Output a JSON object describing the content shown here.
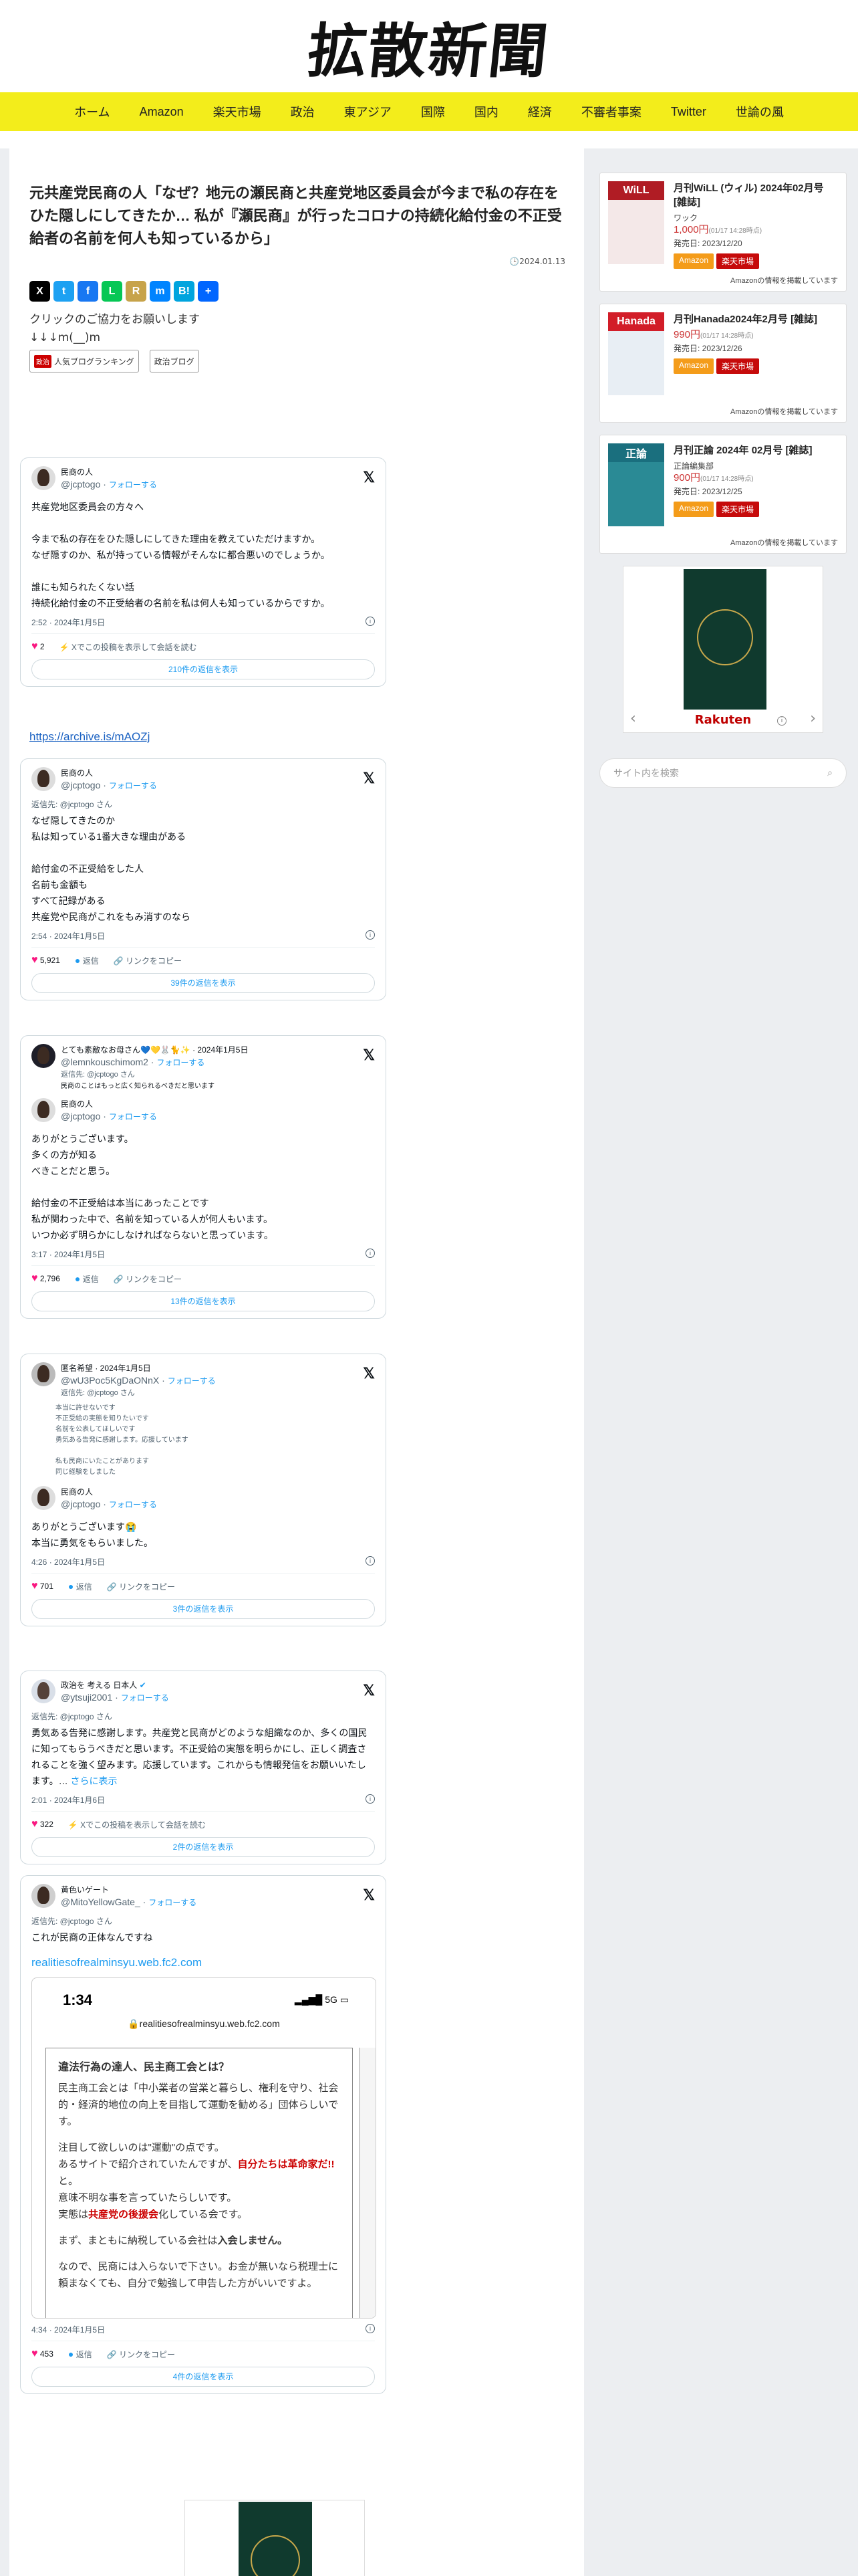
{
  "site": {
    "logo": "拡散新聞"
  },
  "nav": [
    "ホーム",
    "Amazon",
    "楽天市場",
    "政治",
    "東アジア",
    "国際",
    "国内",
    "経済",
    "不審者事案",
    "Twitter",
    "世論の風"
  ],
  "article": {
    "title": "元共産党民商の人「なぜ？地元の瀬民商と共産党地区委員会が今まで私の存在をひた隠しにしてきたか… 私が『瀬民商』が行ったコロナの持続化給付金の不正受給者の名前を何人も知っているから」",
    "date": "2024.01.13",
    "share_icons": [
      {
        "label": "X",
        "color": "#000000"
      },
      {
        "label": "t",
        "color": "#1da1f2"
      },
      {
        "label": "f",
        "color": "#1877f2"
      },
      {
        "label": "L",
        "color": "#06c755"
      },
      {
        "label": "R",
        "color": "#c7a34a"
      },
      {
        "label": "m",
        "color": "#0084ff"
      },
      {
        "label": "B!",
        "color": "#00a4de"
      },
      {
        "label": "+",
        "color": "#0166ff"
      }
    ],
    "click_text": "クリックのご協力をお願いします",
    "arrow_text": "↓↓↓m(__)m",
    "banner1": {
      "mark": "政治",
      "label": "人気ブログランキング"
    },
    "banner2": {
      "label": "政治ブログ"
    },
    "archive_link": "https://archive.is/mAOZj"
  },
  "tweets": [
    {
      "name": "民商の人",
      "handle": "@jcptogo",
      "follow": "フォローする",
      "body": "共産党地区委員会の方々へ\n\n今まで私の存在をひた隠しにしてきた理由を教えていただけますか。\nなぜ隠すのか、私が持っている情報がそんなに都合悪いのでしょうか。\n\n誰にも知られたくない話\n持続化給付金の不正受給者の名前を私は何人も知っているからですか。",
      "time": "2:52 · 2024年1月5日",
      "likes": "2",
      "reply_label": "Xでこの投稿を表示して会話を読む",
      "more": "210件の返信を表示"
    },
    {
      "name": "民商の人",
      "handle": "@jcptogo",
      "follow": "フォローする",
      "reply_to": "返信先: @jcptogo さん",
      "body": "なぜ隠してきたのか\n私は知っている1番大きな理由がある\n\n給付金の不正受給をした人\n名前も金額も\nすべて記録がある\n共産党や民商がこれをもみ消すのなら",
      "time": "2:54 · 2024年1月5日",
      "likes": "5,921",
      "reply_label": "返信",
      "copy_label": "リンクをコピー",
      "more": "39件の返信を表示"
    },
    {
      "name": "とても素敵なお母さん💙💛🐰🐈✨",
      "date": "· 2024年1月5日",
      "handle": "@lemnkouschimom2",
      "follow": "フォローする",
      "reply_to": "返信先: @jcptogo さん",
      "quote_text": "民商のことはもっと広く知られるべきだと思います",
      "name2": "民商の人",
      "handle2": "@jcptogo",
      "follow2": "フォローする",
      "body": "ありがとうございます。\n多くの方が知る\nべきことだと思う。\n\n給付金の不正受給は本当にあったことです\n私が関わった中で、名前を知っている人が何人もいます。\nいつか必ず明らかにしなければならないと思っています。",
      "time": "3:17 · 2024年1月5日",
      "likes": "2,796",
      "reply_label": "返信",
      "copy_label": "リンクをコピー",
      "more": "13件の返信を表示"
    },
    {
      "name": "匿名希望 · 2024年1月5日",
      "handle": "@wU3Poc5KgDaONnX",
      "follow": "フォローする",
      "reply_to": "返信先: @jcptogo さん",
      "quote_lines": [
        "本当に許せないです",
        "不正受給の実態を知りたいです",
        "名前を公表してほしいです",
        "勇気ある告発に感謝します。応援しています",
        "",
        "私も民商にいたことがあります",
        "同じ経験をしました"
      ],
      "name2": "民商の人",
      "handle2": "@jcptogo",
      "follow2": "フォローする",
      "body": "ありがとうございます😭\n本当に勇気をもらいました。",
      "time": "4:26 · 2024年1月5日",
      "likes": "701",
      "reply_label": "返信",
      "copy_label": "リンクをコピー",
      "more": "3件の返信を表示"
    },
    {
      "name": "政治を 考える 日本人",
      "handle": "@ytsuji2001",
      "follow": "フォローする",
      "reply_to": "返信先: @jcptogo さん",
      "body": "勇気ある告発に感謝します。共産党と民商がどのような組織なのか、多くの国民に知ってもらうべきだと思います。不正受給の実態を明らかにし、正しく調査されることを強く望みます。応援しています。これからも情報発信をお願いいたします。…",
      "more_inline": "さらに表示",
      "time": "2:01 · 2024年1月6日",
      "likes": "322",
      "reply_label": "Xでこの投稿を表示して会話を読む",
      "more": "2件の返信を表示"
    },
    {
      "name": "黄色いゲート",
      "handle": "@MitoYellowGate_",
      "follow": "フォローする",
      "reply_to": "返信先: @jcptogo さん",
      "body": "これが民商の正体なんですね",
      "link": "realitiesofrealminsyu.web.fc2.com",
      "phone": {
        "time": "1:34",
        "signal": "5G",
        "url": "realitiesofrealminsyu.web.fc2.com",
        "heading": "違法行為の達人、民主商工会とは？",
        "p1": "民主商工会とは「中小業者の営業と暮らし、権利を守り、社会的・経済的地位の向上を目指して運動を勧める」団体らしいです。",
        "p2a": "注目して欲しいのは\"運動\"の点です。",
        "p2b": "あるサイトで紹介されていたんですが、",
        "p2red": "自分たちは革命家だ!!",
        "p2c": "と。",
        "p2d": "意味不明な事を言っていたらしいです。",
        "p2e": "実態は",
        "p2red2": "共産党の後援会",
        "p2f": "化している会です。",
        "p3a": "まず、まともに納税している会社は",
        "p3b": "入会しません。",
        "p4": "なので、民商には入らないで下さい。お金が無いなら税理士に頼まなくても、自分で勉強して申告した方がいいですよ。"
      },
      "time": "4:34 · 2024年1月5日",
      "likes": "453",
      "reply_label": "返信",
      "copy_label": "リンクをコピー",
      "more": "4件の返信を表示"
    }
  ],
  "sidebar": {
    "books": [
      {
        "title": "月刊WiLL (ウィル) 2024年02月号 [雑誌]",
        "publisher": "ワック",
        "price": "1,000円",
        "price_note": "(01/17 14:28時点)",
        "release": "発売日: 2023/12/20",
        "cover_label": "WiLL",
        "cover_color": "#b01c24",
        "amazon": "Amazon",
        "rakuten": "楽天市場",
        "note": "Amazonの情報を掲載しています"
      },
      {
        "title": "月刊Hanada2024年2月号 [雑誌]",
        "publisher": "",
        "price": "990円",
        "price_note": "(01/17 14:28時点)",
        "release": "発売日: 2023/12/26",
        "cover_label": "Hanada",
        "cover_color": "#d21d28",
        "amazon": "Amazon",
        "rakuten": "楽天市場",
        "note": "Amazonの情報を掲載しています"
      },
      {
        "title": "月刊正論 2024年 02月号 [雑誌]",
        "publisher": "正論編集部",
        "price": "900円",
        "price_note": "(01/17 14:28時点)",
        "release": "発売日: 2023/12/25",
        "cover_label": "正論",
        "cover_color": "#1a7f8e",
        "amazon": "Amazon",
        "rakuten": "楽天市場",
        "note": "Amazonの情報を掲載しています"
      }
    ],
    "rakuten_logo": "Rakuten",
    "search_placeholder": "サイト内を検索"
  }
}
